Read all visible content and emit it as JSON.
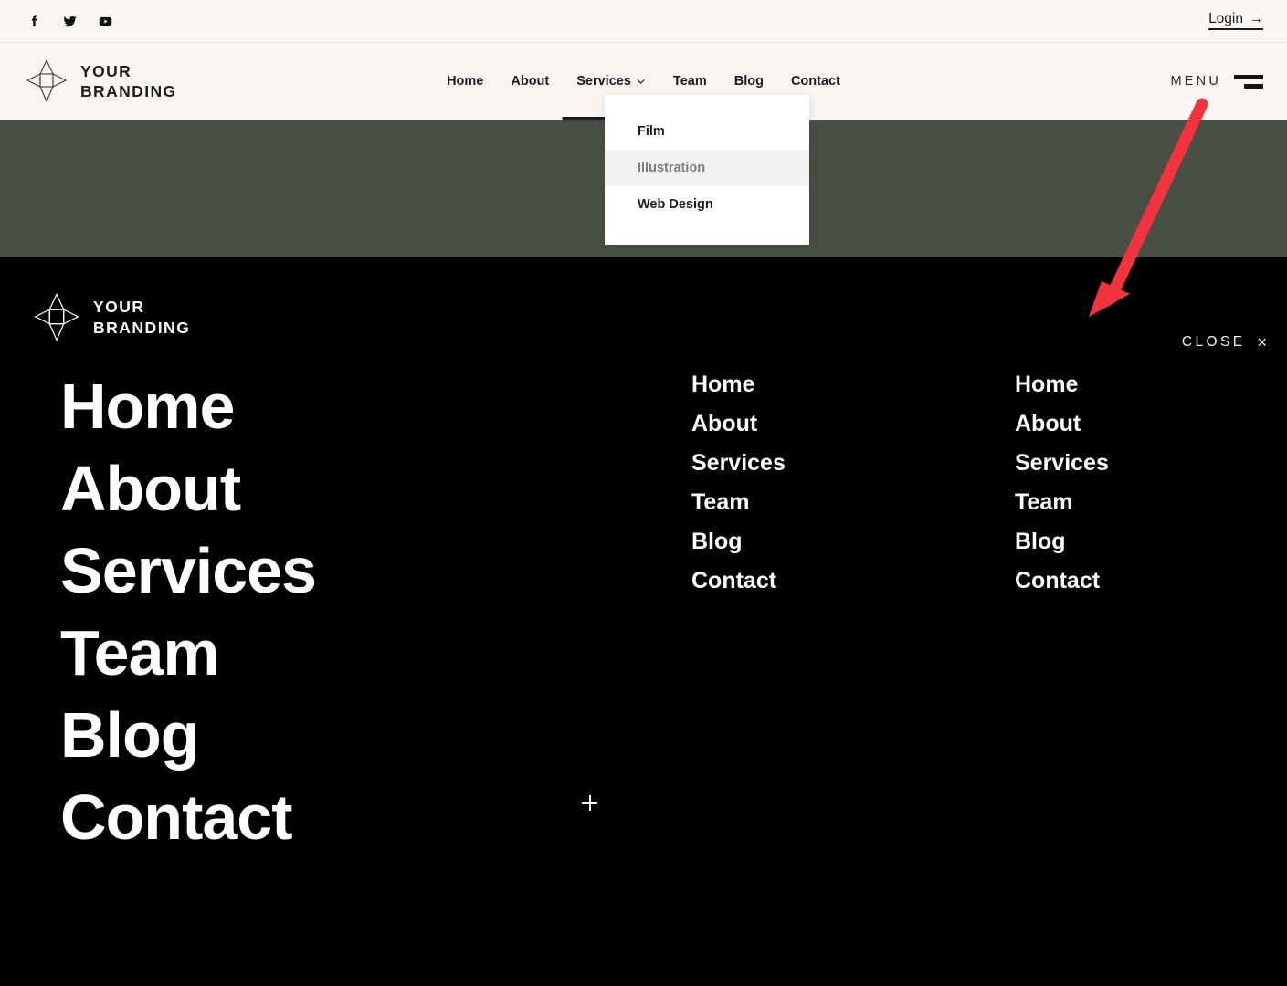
{
  "topbar": {
    "social": [
      {
        "name": "facebook-icon",
        "label": "Facebook"
      },
      {
        "name": "twitter-icon",
        "label": "Twitter"
      },
      {
        "name": "youtube-icon",
        "label": "YouTube"
      }
    ],
    "login_label": "Login",
    "login_arrow": "→"
  },
  "brand": {
    "line1": "YOUR",
    "line2": "BRANDING"
  },
  "nav": {
    "items": [
      {
        "label": "Home",
        "has_submenu": false
      },
      {
        "label": "About",
        "has_submenu": false
      },
      {
        "label": "Services",
        "has_submenu": true
      },
      {
        "label": "Team",
        "has_submenu": false
      },
      {
        "label": "Blog",
        "has_submenu": false
      },
      {
        "label": "Contact",
        "has_submenu": false
      }
    ],
    "menu_label": "MENU"
  },
  "dropdown": {
    "items": [
      {
        "label": "Film",
        "hovered": false
      },
      {
        "label": "Illustration",
        "hovered": true
      },
      {
        "label": "Web Design",
        "hovered": false
      }
    ]
  },
  "overlay": {
    "close_label": "CLOSE",
    "close_x": "×",
    "big_menu": [
      "Home",
      "About",
      "Services",
      "Team",
      "Blog",
      "Contact"
    ],
    "column_mid": [
      "Home",
      "About",
      "Services",
      "Team",
      "Blog",
      "Contact"
    ],
    "column_right": [
      "Home",
      "About",
      "Services",
      "Team",
      "Blog",
      "Contact"
    ]
  },
  "colors": {
    "header_bg": "#F9F5F3",
    "hero_band": "#4A4F45",
    "overlay_bg": "#000000",
    "text_dark": "#1b1b1b",
    "text_light": "#ffffff",
    "dropdown_bg": "#FFFFFF",
    "dropdown_hover_bg": "#F2F2F2",
    "dropdown_hover_text": "#7c7c7c",
    "annotation_red": "#F5333F"
  }
}
